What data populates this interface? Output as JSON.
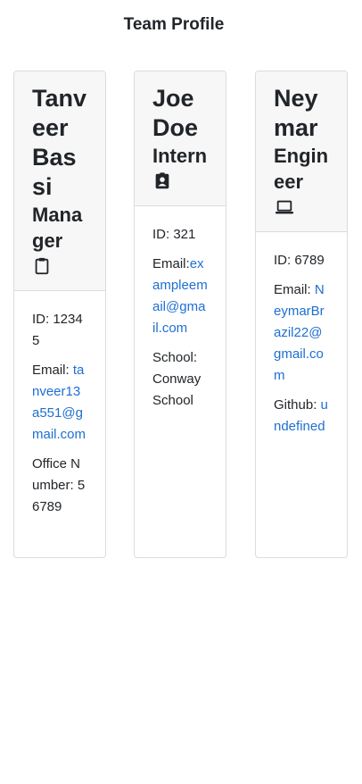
{
  "header": {
    "title": "Team Profile"
  },
  "team": {
    "manager": {
      "name": "Tanveer Bassi",
      "role": "Manager",
      "icon": "clipboard-icon",
      "id_label": "ID:",
      "id": "12345",
      "email_label": "Email:",
      "email": "tanveer13a551@gmail.com",
      "extra_label": "Office Number:",
      "extra_value": "56789"
    },
    "intern": {
      "name": "Joe Doe",
      "role": "Intern",
      "icon": "id-badge-icon",
      "id_label": "ID:",
      "id": "321",
      "email_label": "Email:",
      "email": "exampleemail@gmail.com",
      "extra_label": "School:",
      "extra_value": "Conway School"
    },
    "engineer": {
      "name": "Neymar",
      "role": "Engineer",
      "icon": "laptop-icon",
      "id_label": "ID:",
      "id": "6789",
      "email_label": "Email:",
      "email": "NeymarBrazil22@gmail.com",
      "extra_label": "Github:",
      "extra_value": "undefined"
    }
  },
  "colors": {
    "link": "#1e6fd1",
    "header_bg": "#f7f7f7",
    "border": "#dcdcdc"
  }
}
